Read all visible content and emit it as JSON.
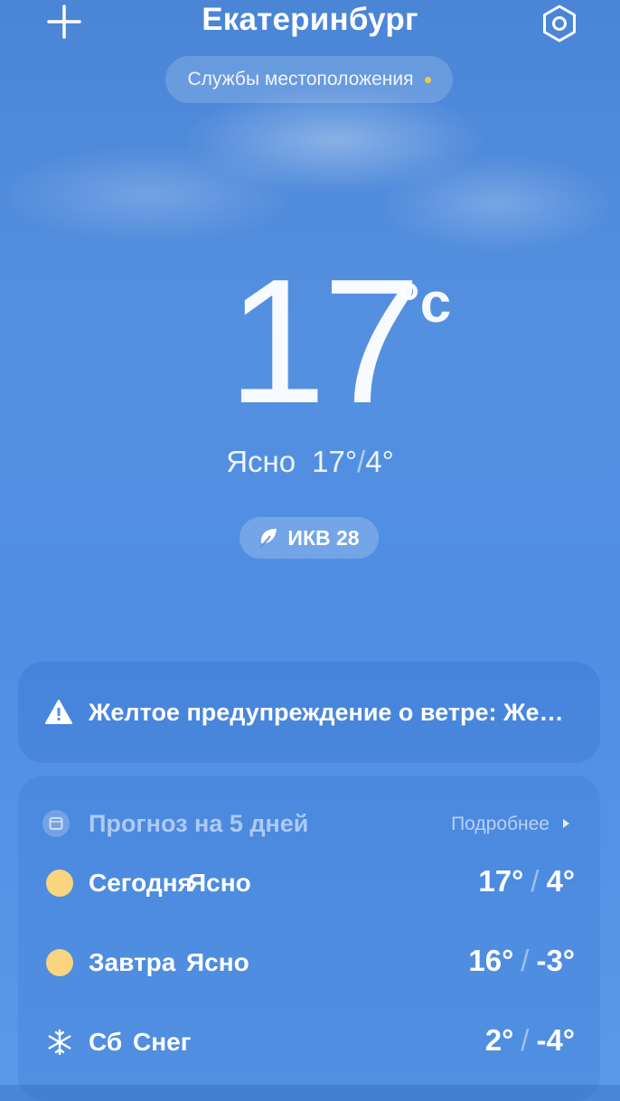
{
  "header": {
    "city": "Екатеринбург",
    "add_icon": "plus-icon",
    "settings_icon": "settings-icon"
  },
  "location_services": {
    "label": "Службы местоположения",
    "dot_color": "#f3c94a"
  },
  "current": {
    "temperature": "17",
    "unit": "°c",
    "condition": "Ясно",
    "high": "17°",
    "low": "4°"
  },
  "aqi": {
    "label": "ИКВ 28",
    "icon": "leaf-icon"
  },
  "alert": {
    "icon": "warning-icon",
    "text": "Желтое предупреждение о ветре: Желтое предупреждение о ветре"
  },
  "forecast": {
    "icon": "calendar-icon",
    "title": "Прогноз на 5 дней",
    "more_label": "Подробнее",
    "days": [
      {
        "day": "Сегодня",
        "condition": "Ясно",
        "high": "17°",
        "low": "4°",
        "icon": "sun-icon"
      },
      {
        "day": "Завтра",
        "condition": "Ясно",
        "high": "16°",
        "low": "-3°",
        "icon": "sun-icon"
      },
      {
        "day": "Сб",
        "condition": "Снег",
        "high": "2°",
        "low": "-4°",
        "icon": "snowflake-icon"
      }
    ]
  },
  "colors": {
    "background": "#4f8ee3",
    "sun": "#f8d57e"
  }
}
